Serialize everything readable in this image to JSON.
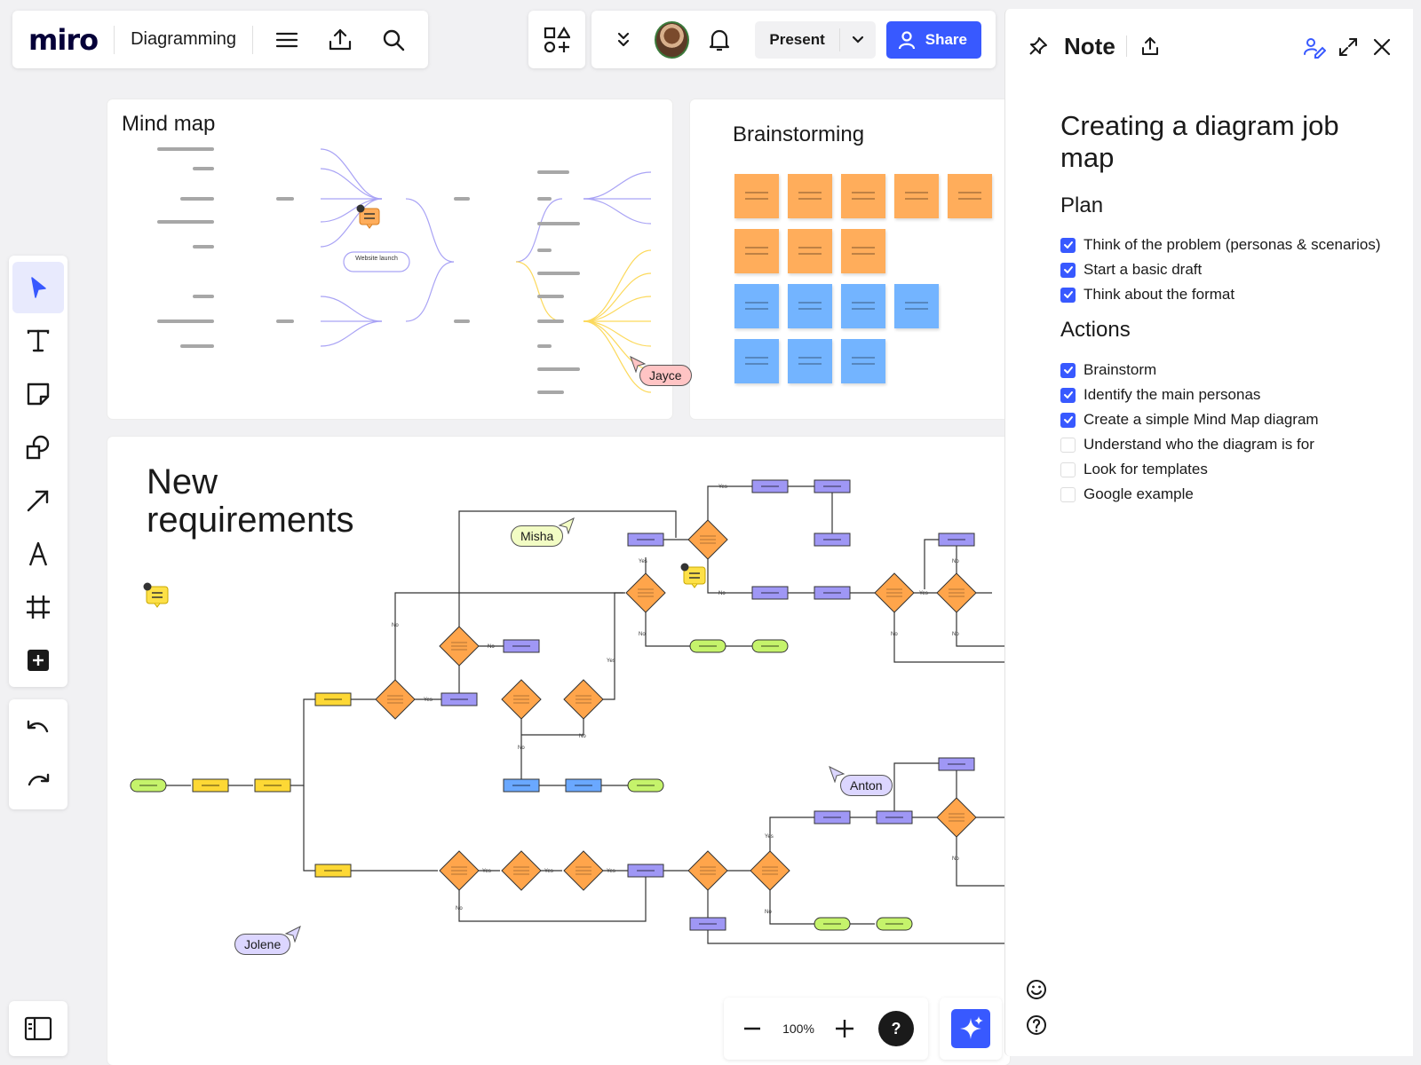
{
  "app": {
    "logo": "miro",
    "board_name": "Diagramming"
  },
  "topbar": {
    "present_label": "Present",
    "share_label": "Share",
    "avatar_name": "user-avatar"
  },
  "colors": {
    "accent": "#3859ff",
    "sticky_orange": "#ffad5b",
    "sticky_blue": "#73b4ff",
    "node_yellow": "#fdd835",
    "node_purple": "#9f97f5",
    "node_green": "#c5f36b",
    "node_blue": "#6aa8ff",
    "diamond_orange": "#ffa54b",
    "jayce_tag": "#ffc4c4",
    "misha_tag": "#f2fcc4",
    "anton_tag": "#dcd6ff",
    "jolene_tag": "#dcd6ff"
  },
  "note": {
    "title": "Note",
    "heading": "Creating a diagram job map",
    "plan_title": "Plan",
    "plan_items": [
      {
        "label": "Think of the problem (personas & scenarios)",
        "checked": true
      },
      {
        "label": "Start a basic draft",
        "checked": true
      },
      {
        "label": "Think about the format",
        "checked": true
      }
    ],
    "actions_title": "Actions",
    "action_items": [
      {
        "label": "Brainstorm",
        "checked": true
      },
      {
        "label": "Identify the main personas",
        "checked": true
      },
      {
        "label": "Create a simple Mind Map diagram",
        "checked": true
      },
      {
        "label": "Understand who the diagram is for",
        "checked": false
      },
      {
        "label": "Look for templates",
        "checked": false
      },
      {
        "label": "Google example",
        "checked": false
      }
    ]
  },
  "canvas": {
    "mindmap": {
      "title": "Mind map",
      "center_label": "Website launch"
    },
    "brainstorm": {
      "title": "Brainstorming"
    },
    "requirements": {
      "title_line1": "New",
      "title_line2": "requirements"
    },
    "cursors": {
      "jayce": "Jayce",
      "misha": "Misha",
      "anton": "Anton",
      "jolene": "Jolene"
    },
    "comment_count": "1",
    "flow_labels": {
      "yes": "Yes",
      "no": "No"
    }
  },
  "zoom": {
    "level": "100%",
    "help": "?"
  },
  "icons": [
    "menu-icon",
    "upload-icon",
    "search-icon",
    "apps-icon",
    "chevron-double-down-icon",
    "bell-icon",
    "chevron-down-icon",
    "user-icon",
    "pin-icon",
    "collaborate-icon",
    "expand-icon",
    "close-icon",
    "cursor-icon",
    "text-icon",
    "sticky-note-icon",
    "shapes-icon",
    "arrow-icon",
    "pen-icon",
    "frame-icon",
    "plus-icon",
    "undo-icon",
    "redo-icon",
    "panel-icon",
    "minus-icon",
    "sparkle-icon",
    "emoji-icon",
    "help-icon"
  ]
}
